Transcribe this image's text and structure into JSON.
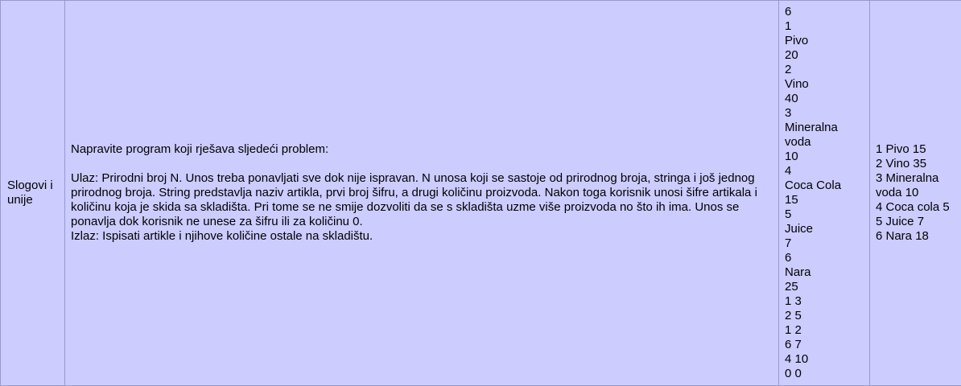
{
  "row": {
    "topic": "Slogovi i unije",
    "description": {
      "intro": "Napravite program koji rješava sljedeći problem:",
      "input": "Ulaz: Prirodni broj N. Unos treba ponavljati sve dok nije ispravan. N unosa koji se sastoje od prirodnog broja, stringa i još jednog prirodnog broja. String predstavlja naziv artikla, prvi broj šifru, a drugi količinu proizvoda. Nakon toga korisnik unosi šifre artikala i količinu koja je skida sa skladišta. Pri tome se ne smije dozvoliti da se s skladišta uzme više proizvoda no što ih ima. Unos se ponavlja dok korisnik ne unese za šifru ili za količinu 0.",
      "output": "Izlaz: Ispisati artikle i njihove količine ostale na skladištu."
    },
    "sample_input": [
      "6",
      "1",
      "Pivo",
      "20",
      "2",
      "Vino",
      "40",
      "3",
      "Mineralna",
      "voda",
      "10",
      "4",
      "Coca Cola",
      "15",
      "5",
      "Juice",
      "7",
      "6",
      "Nara",
      "25",
      "1 3",
      "2 5",
      "1 2",
      "6 7",
      "4 10",
      "0 0"
    ],
    "sample_output": [
      "1 Pivo 15",
      "2 Vino 35",
      "3 Mineralna",
      "voda 10",
      "4 Coca cola 5",
      "5 Juice 7",
      "6 Nara 18"
    ]
  }
}
